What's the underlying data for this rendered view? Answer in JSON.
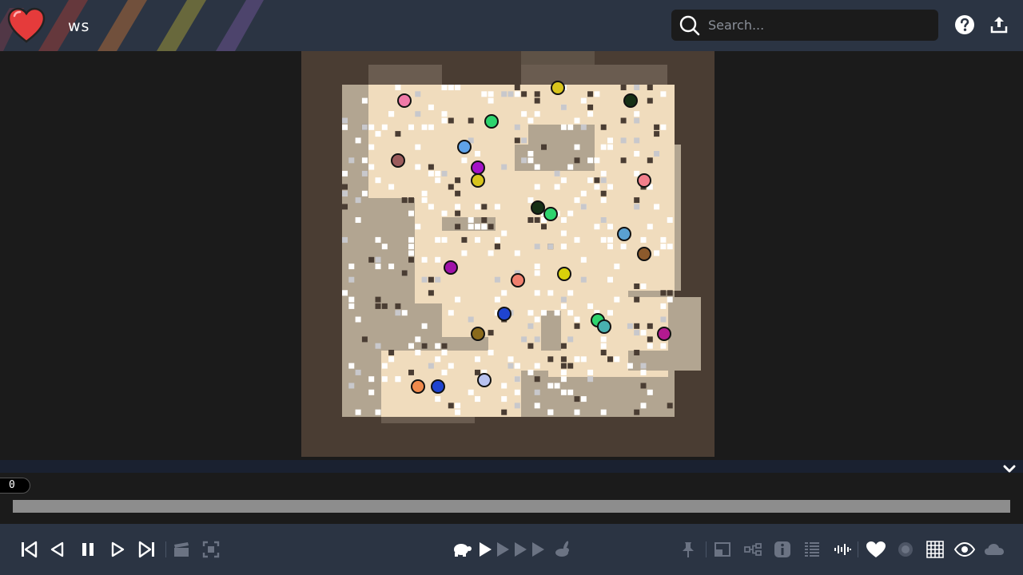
{
  "app": {
    "title": "ws"
  },
  "search": {
    "placeholder": "Search..."
  },
  "timeline": {
    "frame": "0"
  },
  "toolbar": {
    "left": [
      "first-frame",
      "step-back",
      "pause",
      "step-forward",
      "last-frame",
      "record",
      "fullscreen"
    ],
    "speed": [
      "slow-turtle",
      "speed-1",
      "speed-2",
      "speed-3",
      "speed-4",
      "fast-rabbit"
    ],
    "right": [
      "pin",
      "screenshot",
      "tree",
      "info",
      "console",
      "sound",
      "favorite",
      "blur",
      "grid",
      "visibility",
      "cloud"
    ]
  },
  "colors": {
    "topbar": "#2b3443",
    "background": "#1b1b1b",
    "tile_dark": "#4a3d33",
    "tile_mid": "#b2a591",
    "tile_light": "#f0dcbd",
    "tile_white": "#ffffff",
    "accent_heart": "#e53b3b"
  }
}
